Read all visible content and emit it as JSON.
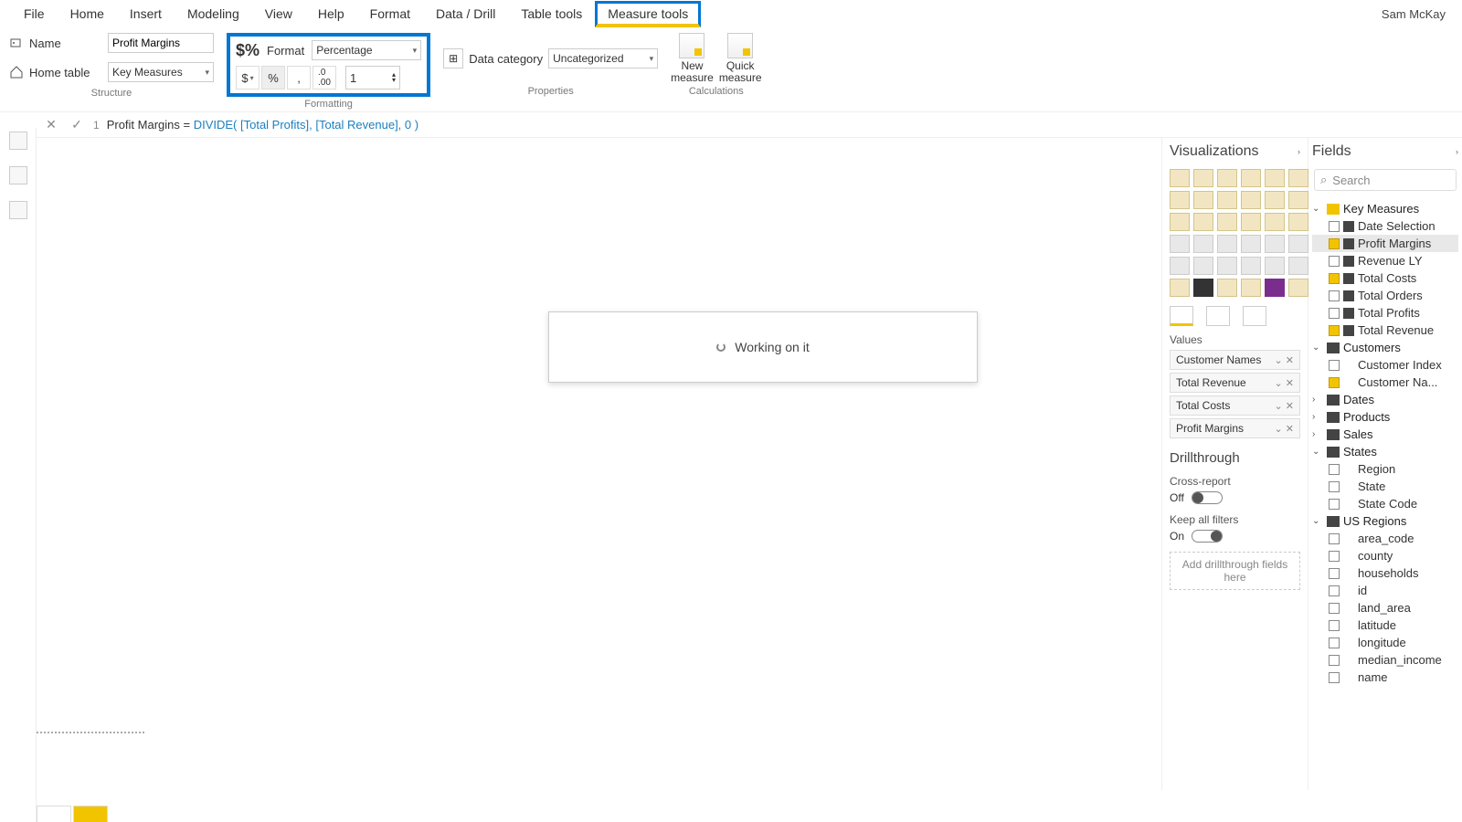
{
  "user": "Sam McKay",
  "menu": [
    "File",
    "Home",
    "Insert",
    "Modeling",
    "View",
    "Help",
    "Format",
    "Data / Drill",
    "Table tools",
    "Measure tools"
  ],
  "menu_active": "Measure tools",
  "structure": {
    "name_lbl": "Name",
    "name_val": "Profit Margins",
    "home_lbl": "Home table",
    "home_val": "Key Measures",
    "group": "Structure"
  },
  "formatting": {
    "format_lbl": "Format",
    "format_val": "Percentage",
    "decimals": "1",
    "group": "Formatting",
    "btns": {
      "cur": "$",
      "pct": "%",
      "comma": ",",
      "dec": ".00"
    }
  },
  "properties": {
    "cat_lbl": "Data category",
    "cat_val": "Uncategorized",
    "group": "Properties"
  },
  "calculations": {
    "new1": "New",
    "new2": "measure",
    "quick1": "Quick",
    "quick2": "measure",
    "group": "Calculations"
  },
  "formula": {
    "line": "1",
    "text_pre": "Profit Margins = ",
    "fn": "DIVIDE",
    "args": "( [Total Profits], [Total Revenue], 0 )"
  },
  "dialog": "Working on it",
  "vis": {
    "title": "Visualizations",
    "values_lbl": "Values",
    "wells": [
      "Customer Names",
      "Total Revenue",
      "Total Costs",
      "Profit Margins"
    ],
    "drill": "Drillthrough",
    "cross": "Cross-report",
    "cross_state": "Off",
    "keep": "Keep all filters",
    "keep_state": "On",
    "hint": "Add drillthrough fields here"
  },
  "fields": {
    "title": "Fields",
    "search": "Search",
    "tables": [
      {
        "name": "Key Measures",
        "fx": true,
        "open": true,
        "items": [
          {
            "name": "Date Selection",
            "chk": false,
            "m": true
          },
          {
            "name": "Profit Margins",
            "chk": true,
            "m": true,
            "sel": true
          },
          {
            "name": "Revenue LY",
            "chk": false,
            "m": true
          },
          {
            "name": "Total Costs",
            "chk": true,
            "m": true
          },
          {
            "name": "Total Orders",
            "chk": false,
            "m": true
          },
          {
            "name": "Total Profits",
            "chk": false,
            "m": true
          },
          {
            "name": "Total Revenue",
            "chk": true,
            "m": true
          }
        ]
      },
      {
        "name": "Customers",
        "open": true,
        "items": [
          {
            "name": "Customer Index",
            "chk": false
          },
          {
            "name": "Customer Na...",
            "chk": true
          }
        ]
      },
      {
        "name": "Dates",
        "open": false
      },
      {
        "name": "Products",
        "open": false
      },
      {
        "name": "Sales",
        "open": false
      },
      {
        "name": "States",
        "open": true,
        "items": [
          {
            "name": "Region",
            "chk": false
          },
          {
            "name": "State",
            "chk": false
          },
          {
            "name": "State Code",
            "chk": false
          }
        ]
      },
      {
        "name": "US Regions",
        "open": true,
        "items": [
          {
            "name": "area_code",
            "chk": false
          },
          {
            "name": "county",
            "chk": false
          },
          {
            "name": "households",
            "chk": false
          },
          {
            "name": "id",
            "chk": false
          },
          {
            "name": "land_area",
            "chk": false
          },
          {
            "name": "latitude",
            "chk": false
          },
          {
            "name": "longitude",
            "chk": false
          },
          {
            "name": "median_income",
            "chk": false
          },
          {
            "name": "name",
            "chk": false
          }
        ]
      }
    ]
  }
}
